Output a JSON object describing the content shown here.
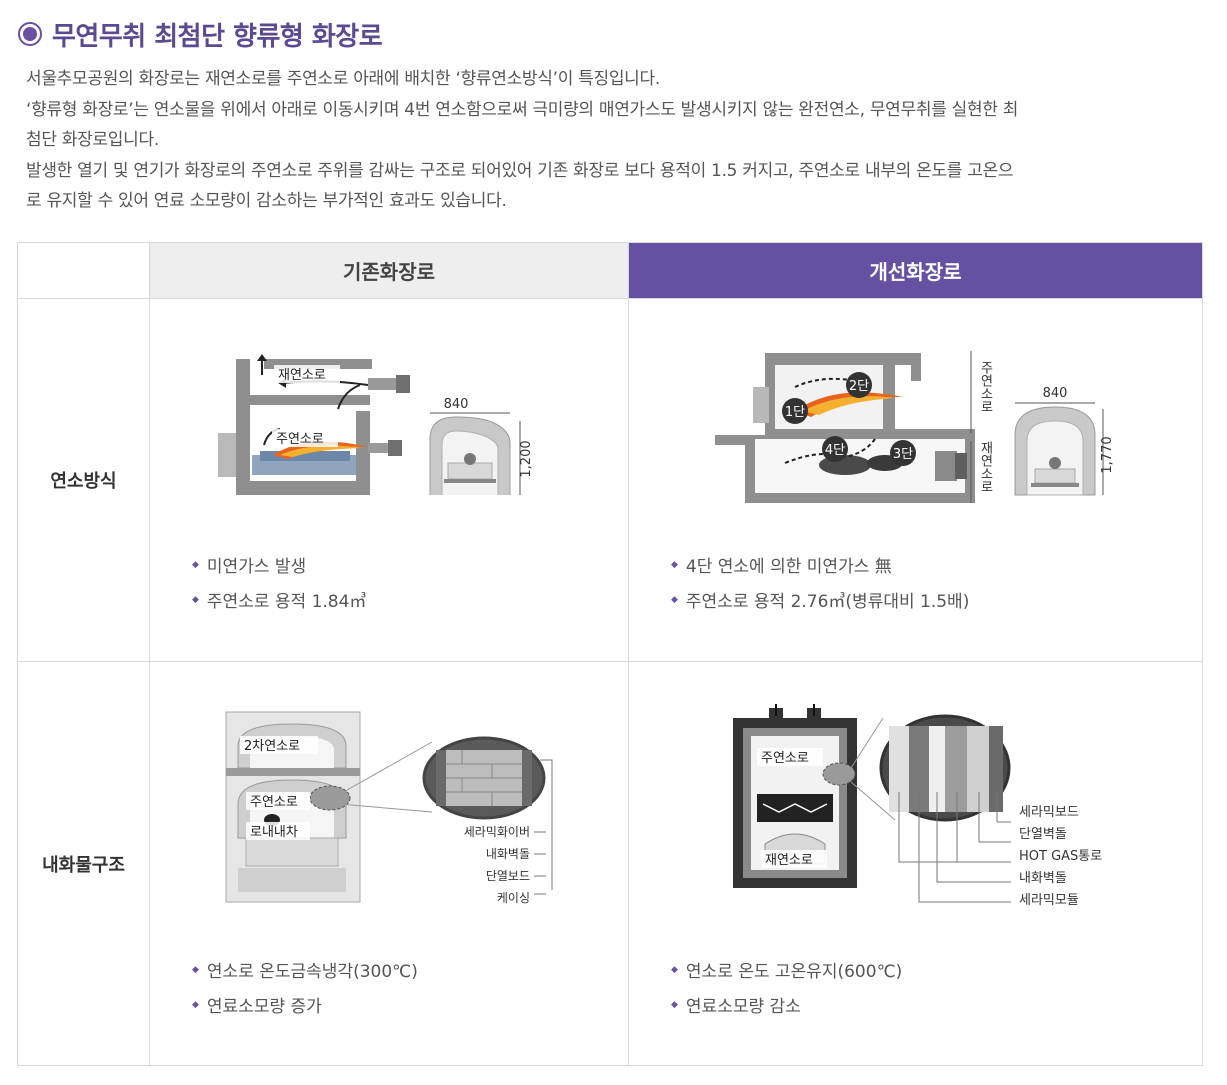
{
  "section": {
    "title": "무연무취 최첨단 향류형 화장로"
  },
  "intro": [
    "서울추모공원의 화장로는 재연소로를 주연소로 아래에 배치한 ‘향류연소방식’이 특징입니다.",
    "‘향류형 화장로’는 연소물을 위에서 아래로 이동시키며 4번 연소함으로써 극미량의 매연가스도 발생시키지 않는 완전연소, 무연무취를 실현한 최",
    "첨단 화장로입니다.",
    "발생한 열기 및 연기가 화장로의 주연소로 주위를 감싸는 구조로 되어있어 기존 화장로 보다 용적이 1.5 커지고, 주연소로 내부의 온도를 고온으",
    "로 유지할 수 있어 연료 소모량이 감소하는 부가적인 효과도 있습니다."
  ],
  "table": {
    "col_old": "기존화장로",
    "col_new": "개선화장로",
    "rows": {
      "combustion": {
        "label": "연소방식",
        "old": {
          "fig": {
            "reburn": "재연소로",
            "main": "주연소로",
            "width": "840",
            "height": "1,200"
          },
          "bullets": [
            "미연가스 발생",
            "주연소로 용적 1.84㎥"
          ]
        },
        "new": {
          "fig": {
            "stage1": "1단",
            "stage2": "2단",
            "stage3": "3단",
            "stage4": "4단",
            "main_vertical": "주연소로",
            "reburn_vertical": "재연소로",
            "width": "840",
            "height": "1,770"
          },
          "bullets": [
            "4단 연소에 의한 미연가스 無",
            "주연소로 용적 2.76㎥(병류대비 1.5배)"
          ]
        }
      },
      "refractory": {
        "label": "내화물구조",
        "old": {
          "fig": {
            "secondary": "2차연소로",
            "main": "주연소로",
            "cart": "로내내차",
            "layers": [
              "세라믹화이버",
              "내화벽돌",
              "단열보드",
              "케이싱"
            ]
          },
          "bullets": [
            "연소로 온도금속냉각(300℃)",
            "연료소모량 증가"
          ]
        },
        "new": {
          "fig": {
            "main": "주연소로",
            "reburn": "재연소로",
            "layers": [
              "세라믹보드",
              "단열벽돌",
              "HOT GAS통로",
              "내화벽돌",
              "세라믹모듈"
            ]
          },
          "bullets": [
            "연소로 온도 고온유지(600℃)",
            "연료소모량 감소"
          ]
        }
      }
    }
  },
  "colors": {
    "accent": "#6550a2",
    "title": "#5b4a8f",
    "border": "#d9d9d9",
    "header_old_bg": "#eeeeee",
    "flame": "#e8641c"
  }
}
